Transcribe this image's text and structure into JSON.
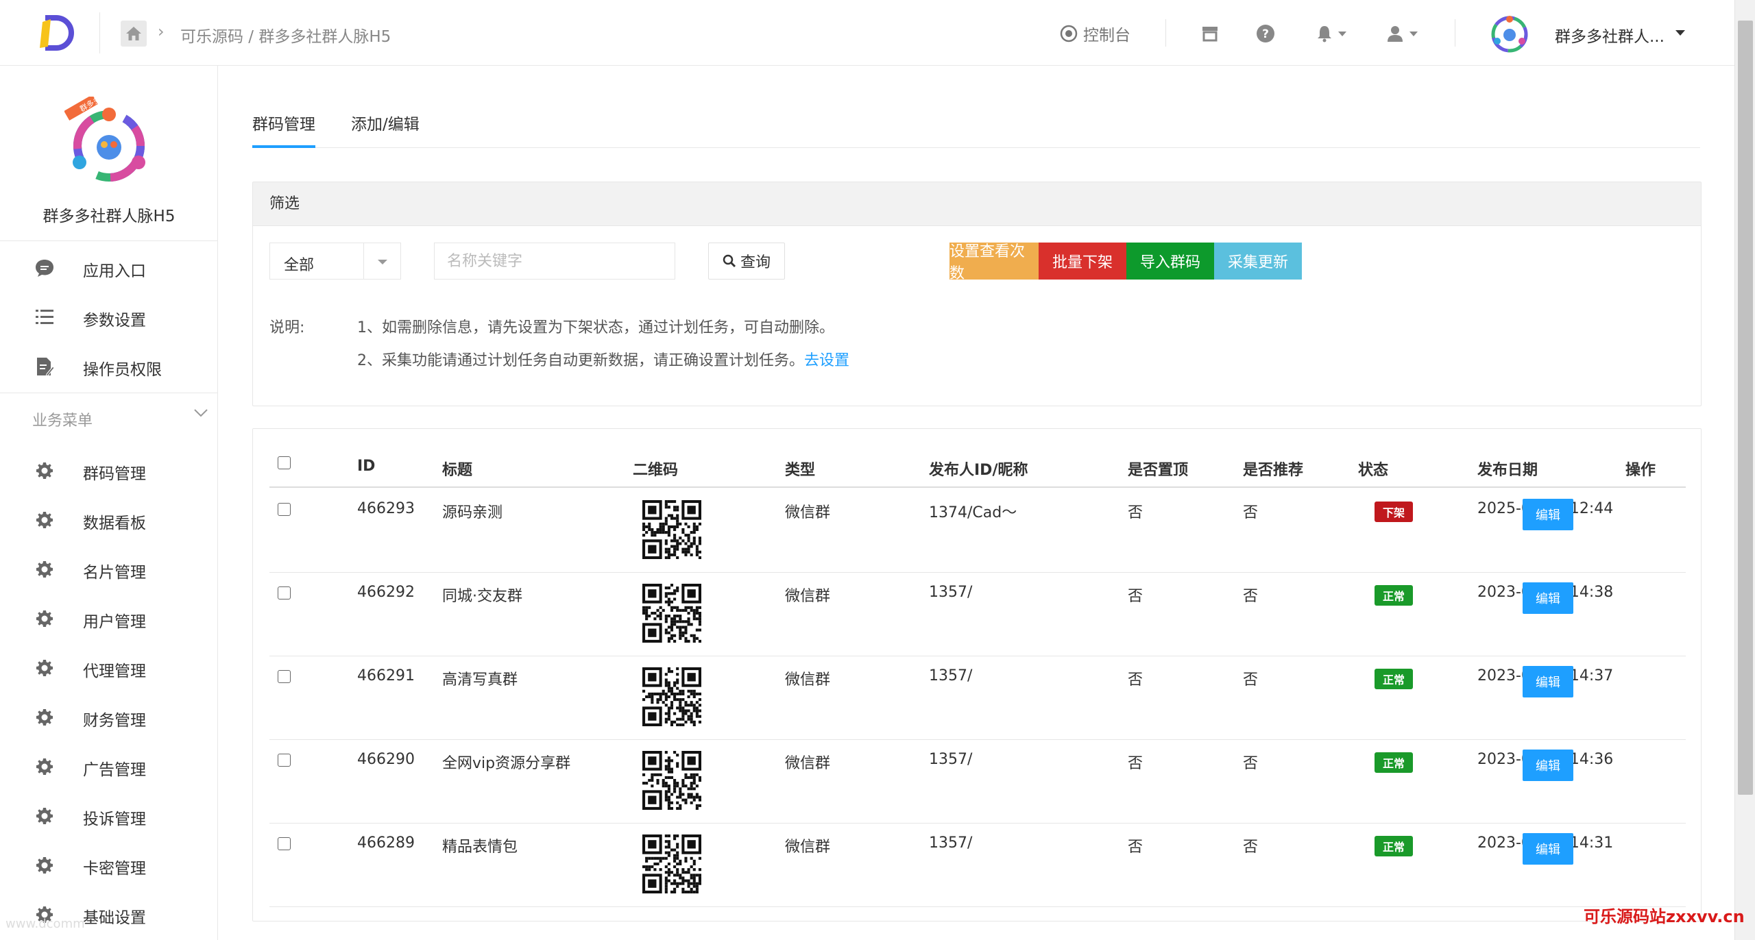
{
  "header": {
    "breadcrumb": "可乐源码 / 群多多社群人脉H5",
    "console_label": "控制台",
    "user_name": "群多多社群人...",
    "accent": "#1e9fff"
  },
  "sidebar": {
    "app_name": "群多多社群人脉H5",
    "logo_badge": "群多多",
    "top_items": [
      {
        "label": "应用入口",
        "icon": "chat-icon"
      },
      {
        "label": "参数设置",
        "icon": "list-icon"
      },
      {
        "label": "操作员权限",
        "icon": "edit-doc-icon"
      }
    ],
    "section_label": "业务菜单",
    "items": [
      {
        "label": "群码管理",
        "icon": "gear-icon"
      },
      {
        "label": "数据看板",
        "icon": "gear-icon"
      },
      {
        "label": "名片管理",
        "icon": "gear-icon"
      },
      {
        "label": "用户管理",
        "icon": "gear-icon"
      },
      {
        "label": "代理管理",
        "icon": "gear-icon"
      },
      {
        "label": "财务管理",
        "icon": "gear-icon"
      },
      {
        "label": "广告管理",
        "icon": "gear-icon"
      },
      {
        "label": "投诉管理",
        "icon": "gear-icon"
      },
      {
        "label": "卡密管理",
        "icon": "gear-icon"
      },
      {
        "label": "基础设置",
        "icon": "gear-icon"
      }
    ]
  },
  "tabs": [
    {
      "label": "群码管理",
      "active": true
    },
    {
      "label": "添加/编辑",
      "active": false
    }
  ],
  "filter": {
    "title": "筛选",
    "select_value": "全部",
    "keyword_placeholder": "名称关键字",
    "query_label": "查询",
    "actions": [
      {
        "label": "设置查看次数",
        "color": "#f0ad4e"
      },
      {
        "label": "批量下架",
        "color": "#d9302c"
      },
      {
        "label": "导入群码",
        "color": "#0d9a2c"
      },
      {
        "label": "采集更新",
        "color": "#5bc0de"
      }
    ],
    "note_label": "说明:",
    "note_line1": "1、如需删除信息，请先设置为下架状态，通过计划任务，可自动删除。",
    "note_line2": "2、采集功能请通过计划任务自动更新数据，请正确设置计划任务。",
    "note_link": "去设置"
  },
  "table": {
    "columns": [
      "ID",
      "标题",
      "二维码",
      "类型",
      "发布人ID/昵称",
      "是否置顶",
      "是否推荐",
      "状态",
      "发布日期",
      "操作"
    ],
    "rows": [
      {
        "id": "466293",
        "title": "源码亲测",
        "type": "微信群",
        "publisher": "1374/Cad～",
        "top": "否",
        "recommend": "否",
        "status": "下架",
        "status_color": "#c0181d",
        "date": "2025-01-09 12:44",
        "action": "编辑"
      },
      {
        "id": "466292",
        "title": "同城·交友群",
        "type": "微信群",
        "publisher": "1357/",
        "top": "否",
        "recommend": "否",
        "status": "正常",
        "status_color": "#1a9a2a",
        "date": "2023-01-15 14:38",
        "action": "编辑"
      },
      {
        "id": "466291",
        "title": "高清写真群",
        "type": "微信群",
        "publisher": "1357/",
        "top": "否",
        "recommend": "否",
        "status": "正常",
        "status_color": "#1a9a2a",
        "date": "2023-01-15 14:37",
        "action": "编辑"
      },
      {
        "id": "466290",
        "title": "全网vip资源分享群",
        "type": "微信群",
        "publisher": "1357/",
        "top": "否",
        "recommend": "否",
        "status": "正常",
        "status_color": "#1a9a2a",
        "date": "2023-01-15 14:36",
        "action": "编辑"
      },
      {
        "id": "466289",
        "title": "精品表情包",
        "type": "微信群",
        "publisher": "1357/",
        "top": "否",
        "recommend": "否",
        "status": "正常",
        "status_color": "#1a9a2a",
        "date": "2023-01-15 14:31",
        "action": "编辑"
      }
    ]
  },
  "watermarks": {
    "left": "www.dcomm",
    "right": "可乐源码站zxxvv.cn"
  }
}
